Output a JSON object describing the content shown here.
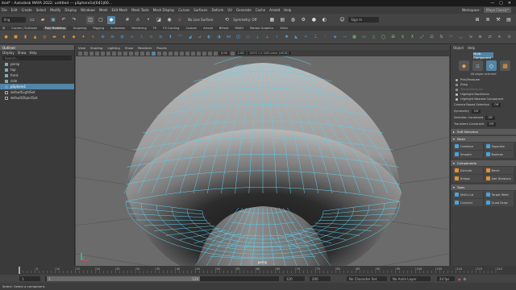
{
  "title_bar": {
    "title": "ited* - Autodesk MAYA 2022: untitled   ---   pSphere1e[641|60...",
    "controls": [
      "—",
      "▢",
      "✕"
    ]
  },
  "menu": {
    "items": [
      "File",
      "Edit",
      "Create",
      "Select",
      "Modify",
      "Display",
      "Windows",
      "Mesh",
      "Edit Mesh",
      "Mesh Tools",
      "Mesh Display",
      "Curves",
      "Surfaces",
      "Deform",
      "UV",
      "Generate",
      "Cache",
      "Arnold",
      "Help"
    ],
    "workspace_label": "Workspace :",
    "workspace_value": "Maya Classic*"
  },
  "status_line": {
    "mode": "ling",
    "no_live_surface": "No Live Surface",
    "symmetry": "Symmetry: Off",
    "sign_in": "Sign In"
  },
  "shelf_tabs": [
    "Curves / Surfaces",
    "Poly Modeling",
    "Sculpting",
    "Rigging",
    "Animation",
    "Rendering",
    "FX",
    "FX Caching",
    "Custom",
    "Arnold",
    "Bifrost",
    "MASH",
    "Motion Graphics",
    "XGen"
  ],
  "shelf_active_tab": "Poly Modeling",
  "outliner": {
    "title": "Outliner",
    "menu": [
      "Display",
      "Show",
      "Help"
    ],
    "search_placeholder": "Search...",
    "items": [
      {
        "label": "persp",
        "type": "camera"
      },
      {
        "label": "top",
        "type": "camera"
      },
      {
        "label": "front",
        "type": "camera"
      },
      {
        "label": "side",
        "type": "camera"
      },
      {
        "label": "pSphere1",
        "type": "mesh",
        "selected": true
      },
      {
        "label": "defaultLightSet",
        "type": "set"
      },
      {
        "label": "defaultObjectSet",
        "type": "set"
      }
    ]
  },
  "viewport": {
    "menu": [
      "View",
      "Shading",
      "Lighting",
      "Show",
      "Renderer",
      "Panels"
    ],
    "near_value": "0.00",
    "far_value": "1.00",
    "color_space": "ACES 1.0 SDR-video (sRGB)",
    "camera_label": "persp"
  },
  "right_panel": {
    "menu": [
      "Object",
      "Help"
    ],
    "mode_label": "Multi-Component",
    "selection_info": "48 edges selected",
    "pick_options": [
      {
        "label": "Pick/Marquee",
        "on": true,
        "kind": "radio"
      },
      {
        "label": "Drag",
        "on": false,
        "kind": "radio"
      },
      {
        "label": "Tweak/Marquee",
        "on": false,
        "kind": "radio",
        "dim": true
      },
      {
        "label": "Highlight Backfaces",
        "on": true,
        "kind": "check"
      },
      {
        "label": "Highlight Nearest Component",
        "on": true,
        "kind": "check"
      }
    ],
    "camera_based_selection": {
      "label": "Camera Based Selection",
      "value": "Off"
    },
    "symmetry": {
      "label": "Symmetry",
      "value": "Off"
    },
    "selection_constraint": {
      "label": "Selection Constraint",
      "value": "Off"
    },
    "transform_constraint": {
      "label": "Transform Constraint",
      "value": "Off"
    },
    "soft_selection": "Soft Selection",
    "mesh_section": "Mesh",
    "mesh_buttons": [
      "Combine",
      "Separate",
      "Smooth",
      "Boolean"
    ],
    "components_section": "Components",
    "components_buttons": [
      "Extrude",
      "Bevel",
      "Bridge",
      "Add Divisions"
    ],
    "tools_section": "Tools",
    "tools_buttons": [
      "Multi-Cut",
      "Target Weld",
      "Connect",
      "Quad Draw"
    ]
  },
  "time_slider": {
    "ticks": [
      "5",
      "10",
      "15",
      "20",
      "25",
      "30",
      "35",
      "40",
      "45",
      "50",
      "55",
      "60",
      "65",
      "70",
      "75",
      "80",
      "85",
      "90",
      "95",
      "100",
      "105",
      "110",
      "115",
      "120"
    ],
    "current_frame": "1"
  },
  "range_bar": {
    "start": "1",
    "start_inner": "1",
    "range_label": "120",
    "end_inner": "120",
    "end": "200",
    "character_set": "No Character Set",
    "anim_layer": "No Anim Layer",
    "fps": "24 fps"
  },
  "help_line": {
    "text": "Select: Select a component."
  },
  "colors": {
    "mesh_wire": "#5ad0f0",
    "selection": "#5285a6",
    "shelf_orange": "#e8902c"
  }
}
